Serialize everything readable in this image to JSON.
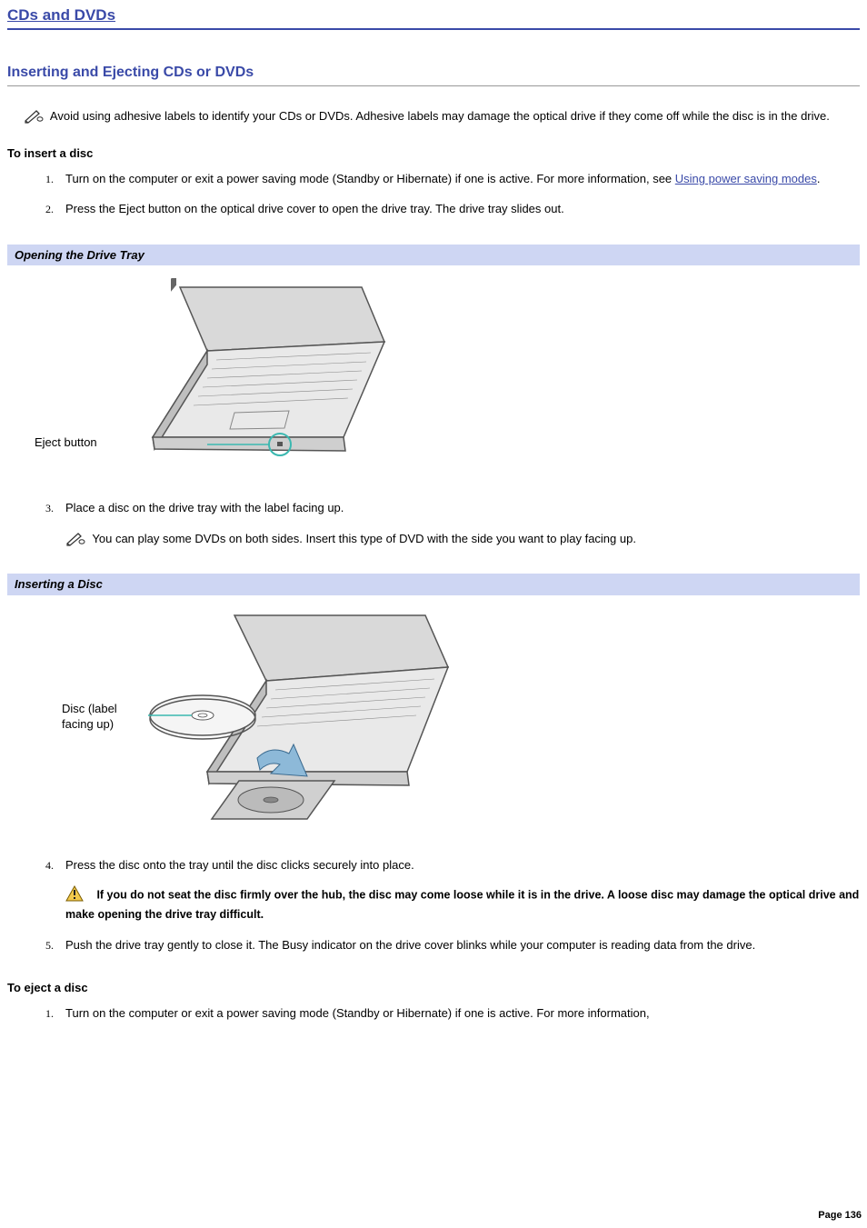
{
  "page_title": "CDs and DVDs",
  "section_title": "Inserting and Ejecting CDs or DVDs",
  "top_note": "Avoid using adhesive labels to identify your CDs or DVDs. Adhesive labels may damage the optical drive if they come off while the disc is in the drive.",
  "insert_heading": "To insert a disc",
  "insert_steps": {
    "s1_pre": "Turn on the computer or exit a power saving mode (Standby or Hibernate) if one is active. For more information, see ",
    "s1_link": "Using power saving modes",
    "s1_post": ".",
    "s2": "Press the Eject button on the optical drive cover to open the drive tray. The drive tray slides out.",
    "s3": "Place a disc on the drive tray with the label facing up.",
    "s3_note": "You can play some DVDs on both sides. Insert this type of DVD with the side you want to play facing up.",
    "s4": "Press the disc onto the tray until the disc clicks securely into place.",
    "s4_warn": "If you do not seat the disc firmly over the hub, the disc may come loose while it is in the drive. A loose disc may damage the optical drive and make opening the drive tray difficult.",
    "s5": "Push the drive tray gently to close it. The Busy indicator on the drive cover blinks while your computer is reading data from the drive."
  },
  "figure1": {
    "caption": "Opening the Drive Tray",
    "label": "Eject button"
  },
  "figure2": {
    "caption": "Inserting a Disc",
    "label": "Disc (label facing up)"
  },
  "eject_heading": "To eject a disc",
  "eject_steps": {
    "s1": "Turn on the computer or exit a power saving mode (Standby or Hibernate) if one is active. For more information,"
  },
  "page_number": "Page 136"
}
